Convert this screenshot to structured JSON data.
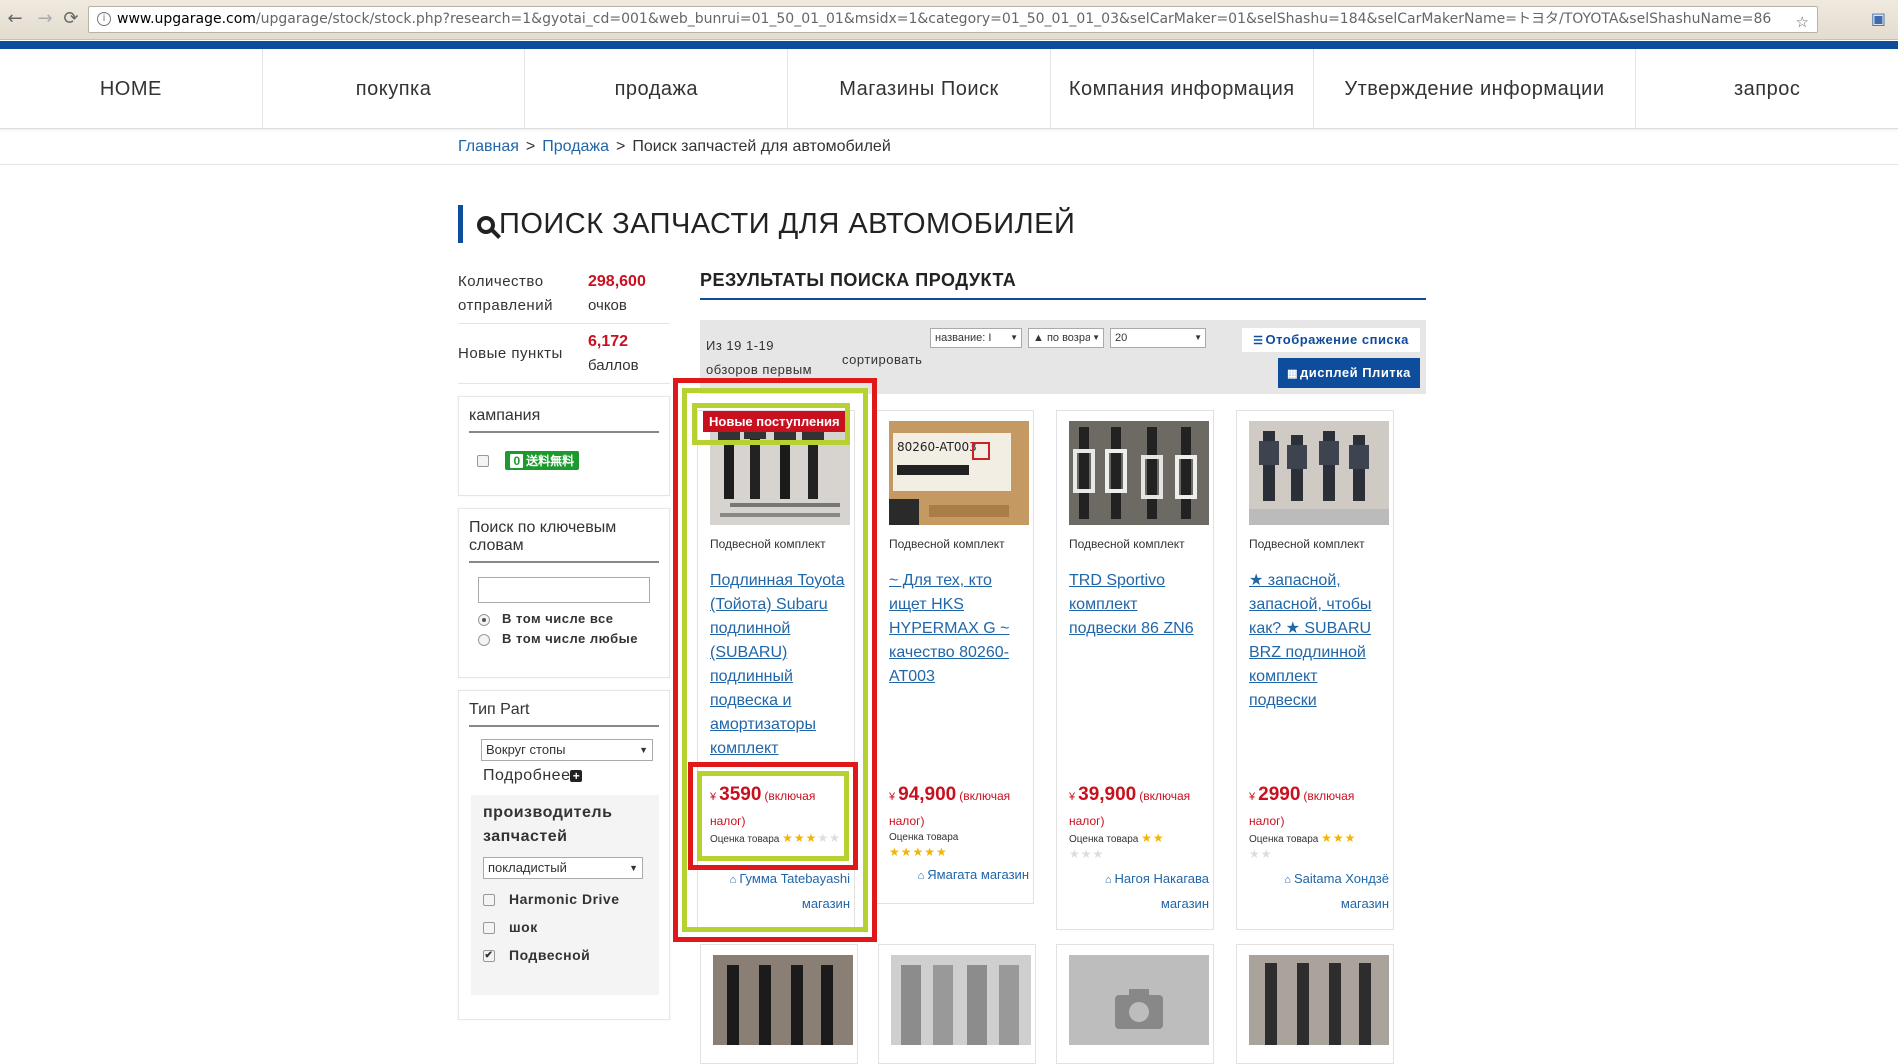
{
  "browser": {
    "url_host": "www.upgarage.com",
    "url_rest": "/upgarage/stock/stock.php?research=1&gyotai_cd=001&web_bunrui=01_50_01_01&msidx=1&category=01_50_01_01_03&selCarMaker=01&selShashu=184&selCarMakerName=トヨタ/TOYOTA&selShashuName=86"
  },
  "nav": {
    "items": [
      "HOME",
      "покупка",
      "продажа",
      "Магазины Поиск",
      "Компания информация",
      "Утверждение информации",
      "запрос"
    ]
  },
  "breadcrumb": {
    "home": "Главная",
    "sale": "Продажа",
    "current": "Поиск запчастей для автомобилей",
    "sep": ">"
  },
  "page_title": "ПОИСК ЗАПЧАСТИ ДЛЯ АВТОМОБИЛЕЙ",
  "sidebar": {
    "stat1_label": "Количество отправлений",
    "stat1_value": "298,600",
    "stat1_unit": "очков",
    "stat2_label": "Новые пункты",
    "stat2_value": "6,172",
    "stat2_unit": "баллов",
    "campaign_title": "кампания",
    "free_ship_zero": "0",
    "free_ship_text": "送料無料",
    "keyword_title": "Поиск по ключевым словам",
    "keyword_value": "",
    "radio_all": "В том числе все",
    "radio_any": "В том числе любые",
    "part_type_title": "Тип Part",
    "part_type_select": "Вокруг стопы",
    "more": "Подробнее",
    "maker_title": "производитель запчастей",
    "maker_select": "покладистый",
    "maker1": "Harmonic Drive",
    "maker2": "шок",
    "maker3": "Подвесной"
  },
  "results": {
    "title": "РЕЗУЛЬТАТЫ ПОИСКА ПРОДУКТА",
    "count_line1": "Из 19  1-19",
    "count_line2": "обзоров первым",
    "sort_label": "сортировать",
    "sort_select1": "название: I",
    "sort_select2": "▲ по возра",
    "per_page": "20",
    "btn_list": "Отображение списка",
    "btn_tile": "дисплей Плитка",
    "new_badge": "Новые поступления"
  },
  "products": [
    {
      "category": "Подвесной комплект",
      "title": "Подлинная Toyota (Тойота) Subaru подлинной (SUBARU) подлинный подвеска и амортизаторы комплект",
      "yen": "¥",
      "price": "3590",
      "tax": "(включая налог)",
      "rating_label": "Оценка товара",
      "stars_on": "★★★",
      "stars_off": "★★",
      "shop": "Гумма Tatebayashi магазин"
    },
    {
      "category": "Подвесной комплект",
      "title": "~ Для тех, кто ищет HKS HYPERMAX G ~ качество 80260-AT003",
      "yen": "¥",
      "price": "94,900",
      "tax": "(включая налог)",
      "rating_label": "Оценка товара",
      "stars_on": "★★★★★",
      "stars_off": "",
      "shop": "Ямагата магазин"
    },
    {
      "category": "Подвесной комплект",
      "title": "TRD Sportivo комплект подвески 86 ZN6",
      "yen": "¥",
      "price": "39,900",
      "tax": "(включая налог)",
      "rating_label": "Оценка товара",
      "stars_on": "★★",
      "stars_off": "★★★",
      "shop": "Нагоя Накагава магазин"
    },
    {
      "category": "Подвесной комплект",
      "title": "★ запасной, запасной, чтобы как? ★ SUBARU BRZ подлинной комплект подвески",
      "yen": "¥",
      "price": "2990",
      "tax": "(включая налог)",
      "rating_label": "Оценка товара",
      "stars_on": "★★★",
      "stars_off": "★★",
      "shop": "Saitama Хондзё магазин"
    }
  ],
  "image_label": "80260-AT003"
}
